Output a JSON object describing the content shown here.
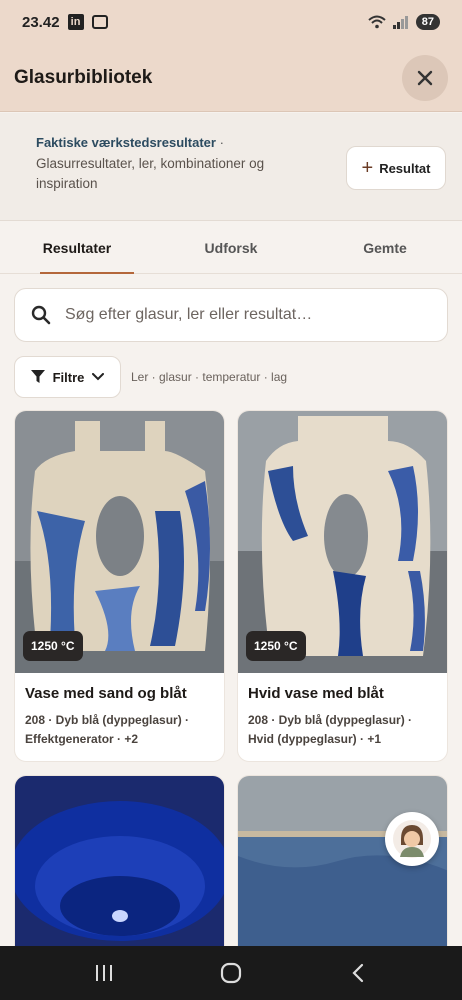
{
  "status": {
    "time": "23.42",
    "battery": "87"
  },
  "header": {
    "title": "Glasurbibliotek"
  },
  "info": {
    "title": "Faktiske værkstedsresultater",
    "separator": "·",
    "subtitle": "Glasurresultater, ler, kombinationer og inspiration",
    "add_label": "Resultat"
  },
  "tabs": [
    {
      "label": "Resultater",
      "active": true
    },
    {
      "label": "Udforsk",
      "active": false
    },
    {
      "label": "Gemte",
      "active": false
    }
  ],
  "search": {
    "placeholder": "Søg efter glasur, ler eller resultat…"
  },
  "filters": {
    "label": "Filtre",
    "hint": "Ler · glasur · temperatur · lag"
  },
  "cards": [
    {
      "temp": "1250 °C",
      "title": "Vase med sand og blåt",
      "meta_line1": "208 · Dyb blå (dyppeglasur) ·",
      "meta_line2": "Effektgenerator · +2"
    },
    {
      "temp": "1250 °C",
      "title": "Hvid vase med blåt",
      "meta_line1": "208 · Dyb blå (dyppeglasur) ·",
      "meta_line2": "Hvid (dyppeglasur) · +1"
    }
  ],
  "colors": {
    "accent": "#b4673a",
    "header_bg": "#ecd9cb",
    "info_title": "#2c4b60",
    "glaze_blue": "#1f3f9e"
  }
}
